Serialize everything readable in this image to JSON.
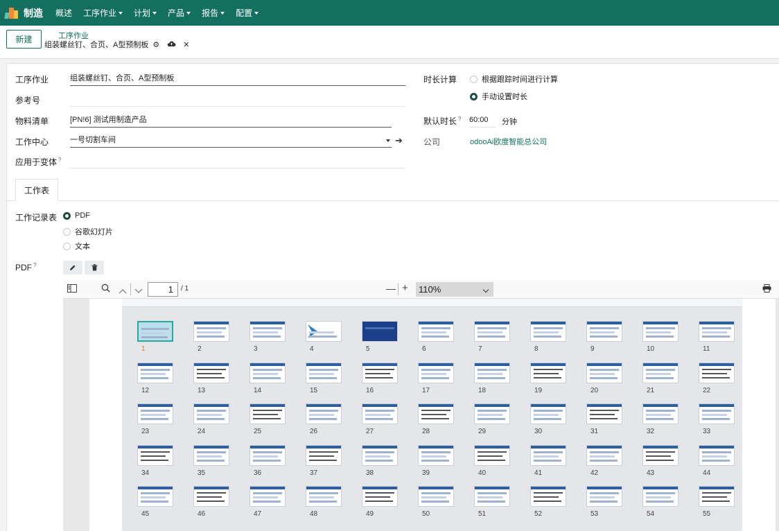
{
  "app": {
    "name": "制造",
    "colors": {
      "nav": "#13705f",
      "accent": "#13705f",
      "selected_thumb": "#2aa6a0"
    }
  },
  "nav": {
    "items": [
      {
        "label": "概述",
        "dropdown": false
      },
      {
        "label": "工序作业",
        "dropdown": true
      },
      {
        "label": "计划",
        "dropdown": true
      },
      {
        "label": "产品",
        "dropdown": true
      },
      {
        "label": "报告",
        "dropdown": true
      },
      {
        "label": "配置",
        "dropdown": true
      }
    ]
  },
  "control": {
    "new_button": "新建",
    "breadcrumb_parent": "工序作业",
    "breadcrumb_current": "组装螺丝钉、合页、A型预制板",
    "icons": [
      "gear-icon",
      "cloud-upload-icon",
      "close-icon"
    ]
  },
  "form": {
    "operation_label": "工序作业",
    "operation_value": "组装螺丝钉、合页、A型预制板",
    "reference_label": "参考号",
    "reference_value": "",
    "bom_label": "物料清单",
    "bom_value": "[PN!6] 测试用制造产品",
    "workcenter_label": "工作中心",
    "workcenter_value": "一号切割车间",
    "variant_label": "应用于变体",
    "variant_value": "",
    "duration_calc_label": "时长计算",
    "duration_options": [
      {
        "label": "根据跟踪时间进行计算",
        "checked": false
      },
      {
        "label": "手动设置时长",
        "checked": true
      }
    ],
    "default_duration_label": "默认时长",
    "default_duration_value": "60:00",
    "default_duration_unit": "分钟",
    "company_label": "公司",
    "company_value": "odooAi欧度智能总公司",
    "help_mark": "?"
  },
  "tabs": [
    {
      "label": "工作表",
      "active": true
    }
  ],
  "worksheet": {
    "type_label": "工作记录表",
    "type_options": [
      {
        "label": "PDF",
        "checked": true
      },
      {
        "label": "谷歌幻灯片",
        "checked": false
      },
      {
        "label": "文本",
        "checked": false
      }
    ],
    "pdf_label": "PDF",
    "edit_icon": "pencil-icon",
    "delete_icon": "trash-icon"
  },
  "pdf_viewer": {
    "page_current": "1",
    "page_total": "/ 1",
    "zoom": "110%",
    "minus": "—",
    "plus": "+",
    "icons": [
      "sidebar-toggle-icon",
      "search-icon",
      "chevron-up-icon",
      "chevron-down-icon",
      "print-icon"
    ],
    "thumbnails": [
      "1",
      "2",
      "3",
      "4",
      "5",
      "6",
      "7",
      "8",
      "9",
      "10",
      "11",
      "12",
      "13",
      "14",
      "15",
      "16",
      "17",
      "18",
      "19",
      "20",
      "21",
      "22",
      "23",
      "24",
      "25",
      "26",
      "27",
      "28",
      "29",
      "30",
      "31",
      "32",
      "33",
      "34",
      "35",
      "36",
      "37",
      "38",
      "39",
      "40",
      "41",
      "42",
      "43",
      "44",
      "45",
      "46",
      "47",
      "48",
      "49",
      "50",
      "51",
      "52",
      "53",
      "54",
      "55"
    ],
    "selected_thumbnail": "1"
  }
}
